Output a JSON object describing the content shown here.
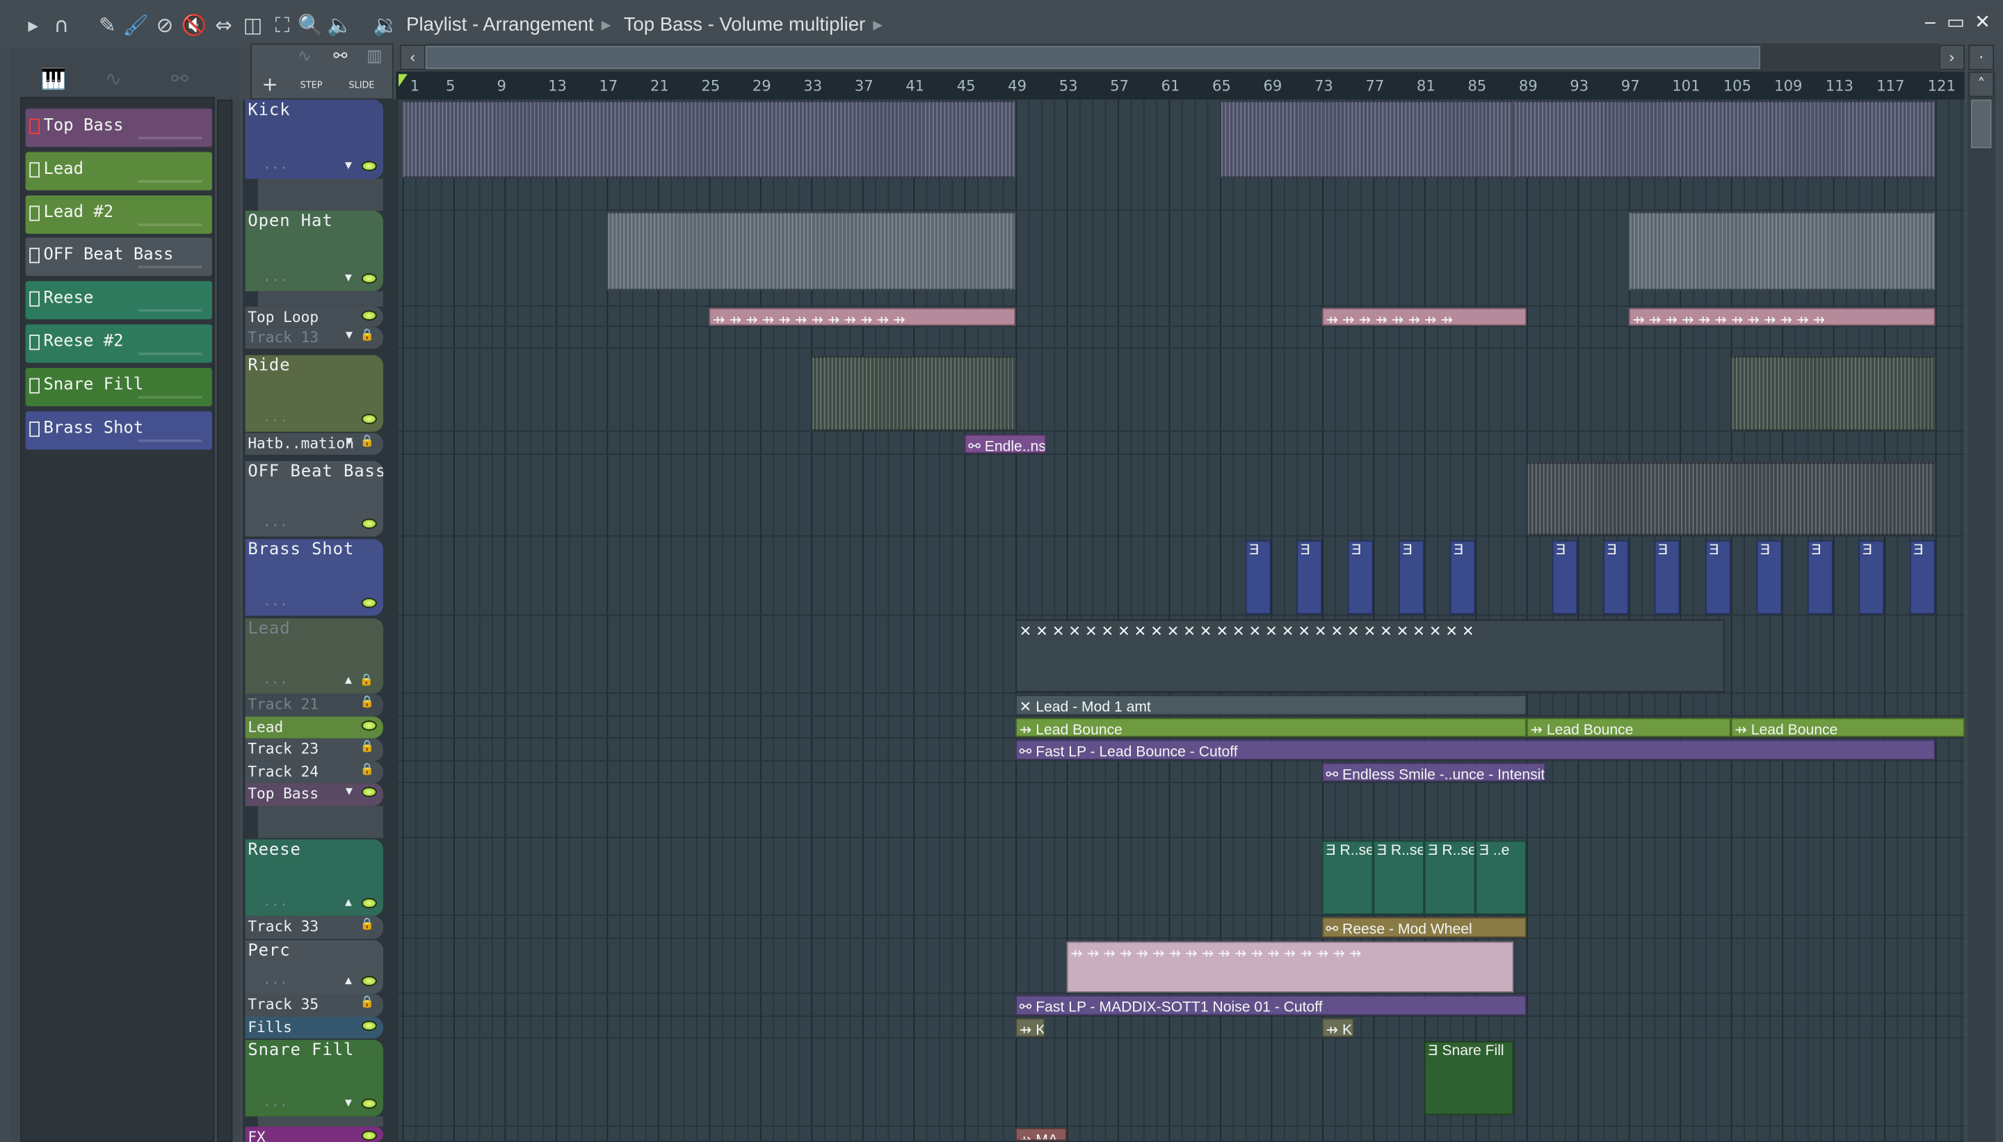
{
  "titlebar": {
    "breadcrumb": [
      "Playlist - Arrangement",
      "Top Bass - Volume multiplier"
    ],
    "icons": [
      "play-arrow",
      "magnet",
      "pencil",
      "paint-brush",
      "delete",
      "mute",
      "slip",
      "slice",
      "select",
      "zoom",
      "playback",
      "speaker"
    ]
  },
  "window": {
    "minimize": "‒",
    "maximize": "▭",
    "close": "✕"
  },
  "tools": {
    "add": "+",
    "step": "STEP",
    "slide": "SLIDE"
  },
  "channels": [
    {
      "label": "Top Bass",
      "color": "#6a4a70",
      "icon": "red"
    },
    {
      "label": "Lead",
      "color": "#5c8a3c"
    },
    {
      "label": "Lead #2",
      "color": "#5c8a3c"
    },
    {
      "label": "OFF Beat Bass",
      "color": "#4c555c"
    },
    {
      "label": "Reese",
      "color": "#2e7a5e"
    },
    {
      "label": "Reese #2",
      "color": "#2e7a5e"
    },
    {
      "label": "Snare Fill",
      "color": "#3f7a35"
    },
    {
      "label": "Brass Shot",
      "color": "#45508e"
    }
  ],
  "ruler": {
    "ticks": [
      "1",
      "5",
      "9",
      "13",
      "17",
      "21",
      "25",
      "29",
      "33",
      "37",
      "41",
      "45",
      "49",
      "53",
      "57",
      "61",
      "65",
      "69",
      "73",
      "77",
      "81",
      "85",
      "89",
      "93",
      "97",
      "101",
      "105",
      "109",
      "113",
      "117",
      "121"
    ]
  },
  "tracks": [
    {
      "name": "Kick",
      "size": "big",
      "color": "#3f4b80",
      "control": "arrow-down"
    },
    {
      "name": "Open Hat",
      "size": "big",
      "color": "#47694d",
      "control": "arrow-down"
    },
    {
      "name": "Top Loop",
      "size": "small",
      "color": "#464f56"
    },
    {
      "name": "Track 13",
      "size": "small",
      "color": "#464f56",
      "dim": true,
      "lock": true,
      "control": "arrow-down"
    },
    {
      "name": "Ride",
      "size": "big",
      "color": "#5a6a45"
    },
    {
      "name": "Hatb..mation",
      "size": "small",
      "color": "#464f56",
      "lock": true,
      "control": "arrow-down"
    },
    {
      "name": "OFF Beat Bass",
      "size": "big",
      "color": "#4a535a"
    },
    {
      "name": "Brass Shot",
      "size": "big",
      "color": "#43508a"
    },
    {
      "name": "Lead",
      "size": "big",
      "color": "#4b5a4a",
      "dim": true,
      "lock": true,
      "control": "arrow-up"
    },
    {
      "name": "Track 21",
      "size": "small",
      "color": "#40494f",
      "dim": true,
      "lock": true
    },
    {
      "name": "Lead",
      "size": "small",
      "color": "#5f8a3e"
    },
    {
      "name": "Track 23",
      "size": "small",
      "color": "#464f56",
      "lock": true
    },
    {
      "name": "Track 24",
      "size": "small",
      "color": "#464f56",
      "lock": true
    },
    {
      "name": "Top Bass",
      "size": "small",
      "color": "#5a4a64",
      "control": "arrow-down"
    },
    {
      "name": "Reese",
      "size": "big",
      "color": "#2e6b58",
      "control": "arrow-up"
    },
    {
      "name": "Track 33",
      "size": "small",
      "color": "#464f56",
      "lock": true
    },
    {
      "name": "Perc",
      "size": "big",
      "color": "#4a535a",
      "control": "arrow-up"
    },
    {
      "name": "Track 35",
      "size": "small",
      "color": "#464f56",
      "lock": true
    },
    {
      "name": "Fills",
      "size": "small",
      "color": "#36586e"
    },
    {
      "name": "Snare Fill",
      "size": "big",
      "color": "#3d6f3a",
      "control": "arrow-down"
    },
    {
      "name": "FX",
      "size": "small",
      "color": "#7a2e7e"
    }
  ],
  "clips": [
    {
      "track": 0,
      "start": 1,
      "end": 49,
      "label": "",
      "kind": "pattern",
      "color": "#4a4f66"
    },
    {
      "track": 0,
      "start": 65,
      "end": 88,
      "label": "",
      "kind": "pattern",
      "color": "#4a4f66"
    },
    {
      "track": 0,
      "start": 88,
      "end": 121,
      "label": "",
      "kind": "pattern",
      "color": "#4a4f66"
    },
    {
      "track": 1,
      "start": 17,
      "end": 49,
      "label": "",
      "kind": "pattern",
      "color": "#5a6670"
    },
    {
      "track": 1,
      "start": 97,
      "end": 121,
      "label": "",
      "kind": "pattern",
      "color": "#5a6670"
    },
    {
      "track": 2,
      "start": 25,
      "end": 49,
      "label": "⇸ ⇸ ⇸ ⇸ ⇸ ⇸ ⇸ ⇸ ⇸ ⇸ ⇸ ⇸",
      "kind": "audio",
      "color": "#b58a9a"
    },
    {
      "track": 2,
      "start": 73,
      "end": 89,
      "label": "⇸ ⇸ ⇸ ⇸ ⇸ ⇸ ⇸ ⇸",
      "kind": "audio",
      "color": "#b58a9a"
    },
    {
      "track": 2,
      "start": 97,
      "end": 121,
      "label": "⇸ ⇸ ⇸ ⇸ ⇸ ⇸ ⇸ ⇸ ⇸ ⇸ ⇸ ⇸",
      "kind": "audio",
      "color": "#b58a9a"
    },
    {
      "track": 4,
      "start": 33,
      "end": 49,
      "label": "",
      "kind": "pattern",
      "color": "#3c4a44"
    },
    {
      "track": 4,
      "start": 105,
      "end": 121,
      "label": "",
      "kind": "pattern",
      "color": "#3c4a44"
    },
    {
      "track": 5,
      "start": 45,
      "end": 51.4,
      "label": "⚯ Endle..nsit",
      "kind": "auto",
      "color": "#7a4f90"
    },
    {
      "track": 6,
      "start": 89,
      "end": 121,
      "label": "",
      "kind": "pattern",
      "color": "#3d464c"
    },
    {
      "track": 7,
      "start": 67,
      "end": 69,
      "label": "Ǝ",
      "kind": "pattern",
      "color": "#3a4a8a"
    },
    {
      "track": 7,
      "start": 71,
      "end": 73,
      "label": "Ǝ",
      "kind": "pattern",
      "color": "#3a4a8a"
    },
    {
      "track": 7,
      "start": 75,
      "end": 77,
      "label": "Ǝ",
      "kind": "pattern",
      "color": "#3a4a8a"
    },
    {
      "track": 7,
      "start": 79,
      "end": 81,
      "label": "Ǝ",
      "kind": "pattern",
      "color": "#3a4a8a"
    },
    {
      "track": 7,
      "start": 83,
      "end": 85,
      "label": "Ǝ",
      "kind": "pattern",
      "color": "#3a4a8a"
    },
    {
      "track": 7,
      "start": 91,
      "end": 93,
      "label": "Ǝ",
      "kind": "pattern",
      "color": "#3a4a8a"
    },
    {
      "track": 7,
      "start": 95,
      "end": 97,
      "label": "Ǝ",
      "kind": "pattern",
      "color": "#3a4a8a"
    },
    {
      "track": 7,
      "start": 99,
      "end": 101,
      "label": "Ǝ",
      "kind": "pattern",
      "color": "#3a4a8a"
    },
    {
      "track": 7,
      "start": 103,
      "end": 105,
      "label": "Ǝ",
      "kind": "pattern",
      "color": "#3a4a8a"
    },
    {
      "track": 7,
      "start": 107,
      "end": 109,
      "label": "Ǝ",
      "kind": "pattern",
      "color": "#3a4a8a"
    },
    {
      "track": 7,
      "start": 111,
      "end": 113,
      "label": "Ǝ",
      "kind": "pattern",
      "color": "#3a4a8a"
    },
    {
      "track": 7,
      "start": 115,
      "end": 117,
      "label": "Ǝ",
      "kind": "pattern",
      "color": "#3a4a8a"
    },
    {
      "track": 7,
      "start": 119,
      "end": 121,
      "label": "Ǝ",
      "kind": "pattern",
      "color": "#3a4a8a"
    },
    {
      "track": 8,
      "start": 49,
      "end": 104.5,
      "label": "✕ ✕ ✕ ✕ ✕ ✕ ✕ ✕ ✕ ✕ ✕ ✕ ✕ ✕ ✕ ✕ ✕ ✕ ✕ ✕ ✕ ✕ ✕ ✕ ✕ ✕ ✕ ✕",
      "kind": "pattern",
      "color": "#3a474e"
    },
    {
      "track": 9,
      "start": 49,
      "end": 89,
      "label": "✕ Lead - Mod 1 amt",
      "kind": "auto",
      "color": "#4a5a60"
    },
    {
      "track": 10,
      "start": 49,
      "end": 89,
      "label": "⇸ Lead Bounce",
      "kind": "audio",
      "color": "#6e9a40"
    },
    {
      "track": 10,
      "start": 89,
      "end": 105,
      "label": "⇸ Lead Bounce",
      "kind": "audio",
      "color": "#6e9a40"
    },
    {
      "track": 10,
      "start": 105,
      "end": 123.3,
      "label": "⇸ Lead Bounce",
      "kind": "audio",
      "color": "#6e9a40"
    },
    {
      "track": 11,
      "start": 49,
      "end": 121,
      "label": "⚯ Fast LP - Lead Bounce - Cutoff",
      "kind": "auto",
      "color": "#62508a"
    },
    {
      "track": 12,
      "start": 73,
      "end": 90.5,
      "label": "⚯ Endless Smile -..unce - Intensit",
      "kind": "auto",
      "color": "#62508a"
    },
    {
      "track": 14,
      "start": 73,
      "end": 77,
      "label": "Ǝ R..se",
      "kind": "pattern",
      "color": "#2b6a58"
    },
    {
      "track": 14,
      "start": 77,
      "end": 81,
      "label": "Ǝ R..se",
      "kind": "pattern",
      "color": "#2b6a58"
    },
    {
      "track": 14,
      "start": 81,
      "end": 85,
      "label": "Ǝ R..se",
      "kind": "pattern",
      "color": "#2b6a58"
    },
    {
      "track": 14,
      "start": 85,
      "end": 89,
      "label": "Ǝ ..e",
      "kind": "pattern",
      "color": "#2b6a58"
    },
    {
      "track": 15,
      "start": 73,
      "end": 89,
      "label": "⚯ Reese - Mod Wheel",
      "kind": "auto",
      "color": "#8a7a45"
    },
    {
      "track": 16,
      "start": 53,
      "end": 88,
      "label": "⇸ ⇸ ⇸ ⇸ ⇸ ⇸ ⇸ ⇸ ⇸ ⇸ ⇸ ⇸ ⇸ ⇸ ⇸ ⇸ ⇸ ⇸",
      "kind": "audio",
      "color": "#c9aec0"
    },
    {
      "track": 17,
      "start": 49,
      "end": 89,
      "label": "⚯ Fast LP - MADDIX-SOTT1 Noise 01 - Cutoff",
      "kind": "auto",
      "color": "#62508a"
    },
    {
      "track": 18,
      "start": 49,
      "end": 51.3,
      "label": "⇸ K..",
      "kind": "audio",
      "color": "#6a6e55"
    },
    {
      "track": 18,
      "start": 73,
      "end": 75.5,
      "label": "⇸ K..",
      "kind": "audio",
      "color": "#6a6e55"
    },
    {
      "track": 19,
      "start": 81,
      "end": 88,
      "label": "Ǝ Snare Fill",
      "kind": "pattern",
      "color": "#2f6030"
    },
    {
      "track": 20,
      "start": 49,
      "end": 53,
      "label": "⇸ MA",
      "kind": "audio",
      "color": "#8a5a5a"
    }
  ]
}
